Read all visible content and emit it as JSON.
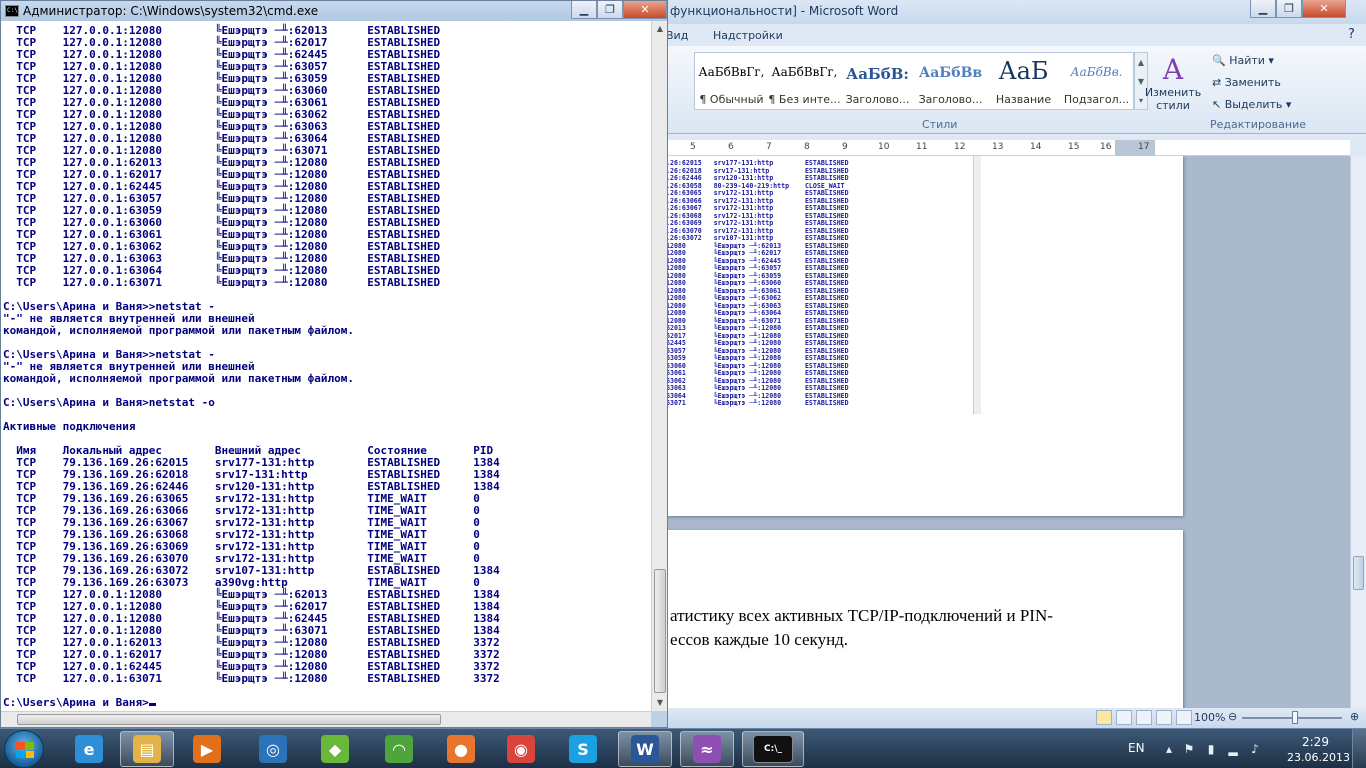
{
  "word": {
    "title": "функциональности] - Microsoft Word",
    "title_bracket": "[",
    "tabs": [
      "Вид",
      "Надстройки"
    ],
    "styles": [
      {
        "sample": "АаБбВвГг,",
        "label": "¶ Обычный"
      },
      {
        "sample": "АаБбВвГг,",
        "label": "¶ Без инте..."
      },
      {
        "sample": "АаБбВ:",
        "label": "Заголово..."
      },
      {
        "sample": "АаБбВв",
        "label": "Заголово..."
      },
      {
        "sample": "АаБ",
        "label": "Название"
      },
      {
        "sample": "АаБбВв.",
        "label": "Подзагол..."
      }
    ],
    "change_styles_label": "Изменить стили",
    "styles_group_label": "Стили",
    "editing": {
      "find": "Найти",
      "replace": "Заменить",
      "select": "Выделить",
      "group_label": "Редактирование"
    },
    "ruler_numbers": [
      "5",
      "6",
      "7",
      "8",
      "9",
      "10",
      "11",
      "12",
      "13",
      "14",
      "15",
      "16",
      "17"
    ],
    "embedded_rows": [
      ".26:62015   srv177-131:http        ESTABLISHED",
      ".26:62018   srv17-131:http         ESTABLISHED",
      ".26:62446   srv120-131:http        ESTABLISHED",
      ".26:63058   80-239-140-219:http    CLOSE_WAIT",
      ".26:63065   srv172-131:http        ESTABLISHED",
      ".26:63066   srv172-131:http        ESTABLISHED",
      ".26:63067   srv172-131:http        ESTABLISHED",
      ".26:63068   srv172-131:http        ESTABLISHED",
      ".26:63069   srv172-131:http        ESTABLISHED",
      ".26:63070   srv172-131:http        ESTABLISHED",
      ".26:63072   srv107-131:http        ESTABLISHED",
      "12080       ╚Ешэрщтэ ─╨:62013      ESTABLISHED",
      "12080       ╚Ешэрщтэ ─╨:62017      ESTABLISHED",
      "12080       ╚Ешэрщтэ ─╨:62445      ESTABLISHED",
      "12080       ╚Ешэрщтэ ─╨:63057      ESTABLISHED",
      "12080       ╚Ешэрщтэ ─╨:63059      ESTABLISHED",
      "12080       ╚Ешэрщтэ ─╨:63060      ESTABLISHED",
      "12080       ╚Ешэрщтэ ─╨:63061      ESTABLISHED",
      "12080       ╚Ешэрщтэ ─╨:63062      ESTABLISHED",
      "12080       ╚Ешэрщтэ ─╨:63063      ESTABLISHED",
      "12080       ╚Ешэрщтэ ─╨:63064      ESTABLISHED",
      "12080       ╚Ешэрщтэ ─╨:63071      ESTABLISHED",
      "62013       ╚Ешэрщтэ ─╨:12080      ESTABLISHED",
      "62017       ╚Ешэрщтэ ─╨:12080      ESTABLISHED",
      "62445       ╚Ешэрщтэ ─╨:12080      ESTABLISHED",
      "63057       ╚Ешэрщтэ ─╨:12080      ESTABLISHED",
      "63059       ╚Ешэрщтэ ─╨:12080      ESTABLISHED",
      "63060       ╚Ешэрщтэ ─╨:12080      ESTABLISHED",
      "63061       ╚Ешэрщтэ ─╨:12080      ESTABLISHED",
      "63062       ╚Ешэрщтэ ─╨:12080      ESTABLISHED",
      "63063       ╚Ешэрщтэ ─╨:12080      ESTABLISHED",
      "63064       ╚Ешэрщтэ ─╨:12080      ESTABLISHED",
      "63071       ╚Ешэрщтэ ─╨:12080      ESTABLISHED"
    ],
    "doc_text_line1": "атистику всех активных TCP/IP-подключений и PIN-",
    "doc_text_line2": "ессов каждые 10 секунд.",
    "zoom": "100%"
  },
  "console": {
    "title": "Администратор: C:\\Windows\\system32\\cmd.exe",
    "lines": [
      "  TCP    127.0.0.1:12080        ╚Ешэрщтэ ─╨:62013      ESTABLISHED",
      "  TCP    127.0.0.1:12080        ╚Ешэрщтэ ─╨:62017      ESTABLISHED",
      "  TCP    127.0.0.1:12080        ╚Ешэрщтэ ─╨:62445      ESTABLISHED",
      "  TCP    127.0.0.1:12080        ╚Ешэрщтэ ─╨:63057      ESTABLISHED",
      "  TCP    127.0.0.1:12080        ╚Ешэрщтэ ─╨:63059      ESTABLISHED",
      "  TCP    127.0.0.1:12080        ╚Ешэрщтэ ─╨:63060      ESTABLISHED",
      "  TCP    127.0.0.1:12080        ╚Ешэрщтэ ─╨:63061      ESTABLISHED",
      "  TCP    127.0.0.1:12080        ╚Ешэрщтэ ─╨:63062      ESTABLISHED",
      "  TCP    127.0.0.1:12080        ╚Ешэрщтэ ─╨:63063      ESTABLISHED",
      "  TCP    127.0.0.1:12080        ╚Ешэрщтэ ─╨:63064      ESTABLISHED",
      "  TCP    127.0.0.1:12080        ╚Ешэрщтэ ─╨:63071      ESTABLISHED",
      "  TCP    127.0.0.1:62013        ╚Ешэрщтэ ─╨:12080      ESTABLISHED",
      "  TCP    127.0.0.1:62017        ╚Ешэрщтэ ─╨:12080      ESTABLISHED",
      "  TCP    127.0.0.1:62445        ╚Ешэрщтэ ─╨:12080      ESTABLISHED",
      "  TCP    127.0.0.1:63057        ╚Ешэрщтэ ─╨:12080      ESTABLISHED",
      "  TCP    127.0.0.1:63059        ╚Ешэрщтэ ─╨:12080      ESTABLISHED",
      "  TCP    127.0.0.1:63060        ╚Ешэрщтэ ─╨:12080      ESTABLISHED",
      "  TCP    127.0.0.1:63061        ╚Ешэрщтэ ─╨:12080      ESTABLISHED",
      "  TCP    127.0.0.1:63062        ╚Ешэрщтэ ─╨:12080      ESTABLISHED",
      "  TCP    127.0.0.1:63063        ╚Ешэрщтэ ─╨:12080      ESTABLISHED",
      "  TCP    127.0.0.1:63064        ╚Ешэрщтэ ─╨:12080      ESTABLISHED",
      "  TCP    127.0.0.1:63071        ╚Ешэрщтэ ─╨:12080      ESTABLISHED",
      "",
      "C:\\Users\\Арина и Ваня>>netstat -",
      "\"-\" не является внутренней или внешней",
      "командой, исполняемой программой или пакетным файлом.",
      "",
      "C:\\Users\\Арина и Ваня>>netstat -",
      "\"-\" не является внутренней или внешней",
      "командой, исполняемой программой или пакетным файлом.",
      "",
      "C:\\Users\\Арина и Ваня>netstat -o",
      "",
      "Активные подключения",
      "",
      "  Имя    Локальный адрес        Внешний адрес          Состояние       PID",
      "  TCP    79.136.169.26:62015    srv177-131:http        ESTABLISHED     1384",
      "  TCP    79.136.169.26:62018    srv17-131:http         ESTABLISHED     1384",
      "  TCP    79.136.169.26:62446    srv120-131:http        ESTABLISHED     1384",
      "  TCP    79.136.169.26:63065    srv172-131:http        TIME_WAIT       0",
      "  TCP    79.136.169.26:63066    srv172-131:http        TIME_WAIT       0",
      "  TCP    79.136.169.26:63067    srv172-131:http        TIME_WAIT       0",
      "  TCP    79.136.169.26:63068    srv172-131:http        TIME_WAIT       0",
      "  TCP    79.136.169.26:63069    srv172-131:http        TIME_WAIT       0",
      "  TCP    79.136.169.26:63070    srv172-131:http        TIME_WAIT       0",
      "  TCP    79.136.169.26:63072    srv107-131:http        ESTABLISHED     1384",
      "  TCP    79.136.169.26:63073    a390vg:http            TIME_WAIT       0",
      "  TCP    127.0.0.1:12080        ╚Ешэрщтэ ─╨:62013      ESTABLISHED     1384",
      "  TCP    127.0.0.1:12080        ╚Ешэрщтэ ─╨:62017      ESTABLISHED     1384",
      "  TCP    127.0.0.1:12080        ╚Ешэрщтэ ─╨:62445      ESTABLISHED     1384",
      "  TCP    127.0.0.1:12080        ╚Ешэрщтэ ─╨:63071      ESTABLISHED     1384",
      "  TCP    127.0.0.1:62013        ╚Ешэрщтэ ─╨:12080      ESTABLISHED     3372",
      "  TCP    127.0.0.1:62017        ╚Ешэрщтэ ─╨:12080      ESTABLISHED     3372",
      "  TCP    127.0.0.1:62445        ╚Ешэрщтэ ─╨:12080      ESTABLISHED     3372",
      "  TCP    127.0.0.1:63071        ╚Ешэрщтэ ─╨:12080      ESTABLISHED     3372",
      ""
    ],
    "prompt": "C:\\Users\\Арина и Ваня>"
  },
  "taskbar": {
    "apps": [
      {
        "name": "internet-explorer",
        "glyph": "e",
        "color": "#2d8fd8"
      },
      {
        "name": "windows-explorer",
        "glyph": "▤",
        "color": "#e3b34a"
      },
      {
        "name": "media-center",
        "glyph": "▶",
        "color": "#e0701c"
      },
      {
        "name": "browser-ring",
        "glyph": "◎",
        "color": "#2a73b8"
      },
      {
        "name": "chromium-like",
        "glyph": "◆",
        "color": "#6ab83a"
      },
      {
        "name": "wifi-app",
        "glyph": "◠",
        "color": "#4ea53c"
      },
      {
        "name": "firefox",
        "glyph": "●",
        "color": "#e8752b"
      },
      {
        "name": "chrome",
        "glyph": "◉",
        "color": "#d9453a"
      },
      {
        "name": "skype",
        "glyph": "S",
        "color": "#1ba1e2"
      },
      {
        "name": "word",
        "glyph": "W",
        "color": "#2b5797"
      },
      {
        "name": "purple-app",
        "glyph": "≈",
        "color": "#8e4fb2"
      },
      {
        "name": "cmd",
        "glyph": "C:\\_",
        "color": "#111111"
      }
    ],
    "language": "EN",
    "time": "2:29",
    "date": "23.06.2013"
  }
}
